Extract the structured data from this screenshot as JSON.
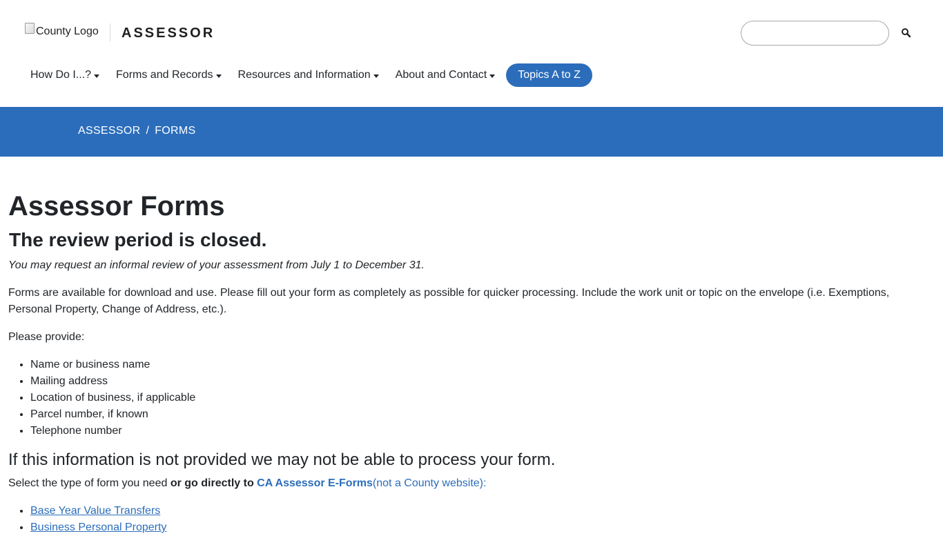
{
  "header": {
    "logo_alt": "County Logo",
    "brand": "ASSESSOR",
    "search_placeholder": ""
  },
  "nav": {
    "items": [
      {
        "label": "How Do I...?"
      },
      {
        "label": "Forms and Records"
      },
      {
        "label": "Resources and Information"
      },
      {
        "label": "About and Contact"
      }
    ],
    "topics_button": "Topics A to Z"
  },
  "breadcrumb": {
    "items": [
      "ASSESSOR",
      "FORMS"
    ],
    "separator": "/"
  },
  "main": {
    "title": "Assessor Forms",
    "subtitle": "The review period is closed.",
    "italic_note": "You may request an informal review of your assessment from July 1 to December 31.",
    "paragraph": "Forms are available for download and use. Please fill out your form as completely as possible for quicker processing. Include the work unit or topic on the envelope (i.e. Exemptions, Personal Property, Change of Address, etc.).",
    "provide_label": "Please provide:",
    "provide_items": [
      "Name or business name",
      "Mailing address",
      "Location of business, if applicable",
      "Parcel number, if known",
      "Telephone number"
    ],
    "warning": "If this information is not provided we may not be able to process your form.",
    "select_prefix": "Select the type of form you need ",
    "select_bold": "or go directly to ",
    "eforms_link": "CA Assessor E-Forms",
    "eforms_note": "(not a County website):",
    "form_links": [
      "Base Year Value Transfers",
      "Business Personal Property"
    ]
  },
  "colors": {
    "accent": "#2b6dbb",
    "text": "#212529"
  }
}
